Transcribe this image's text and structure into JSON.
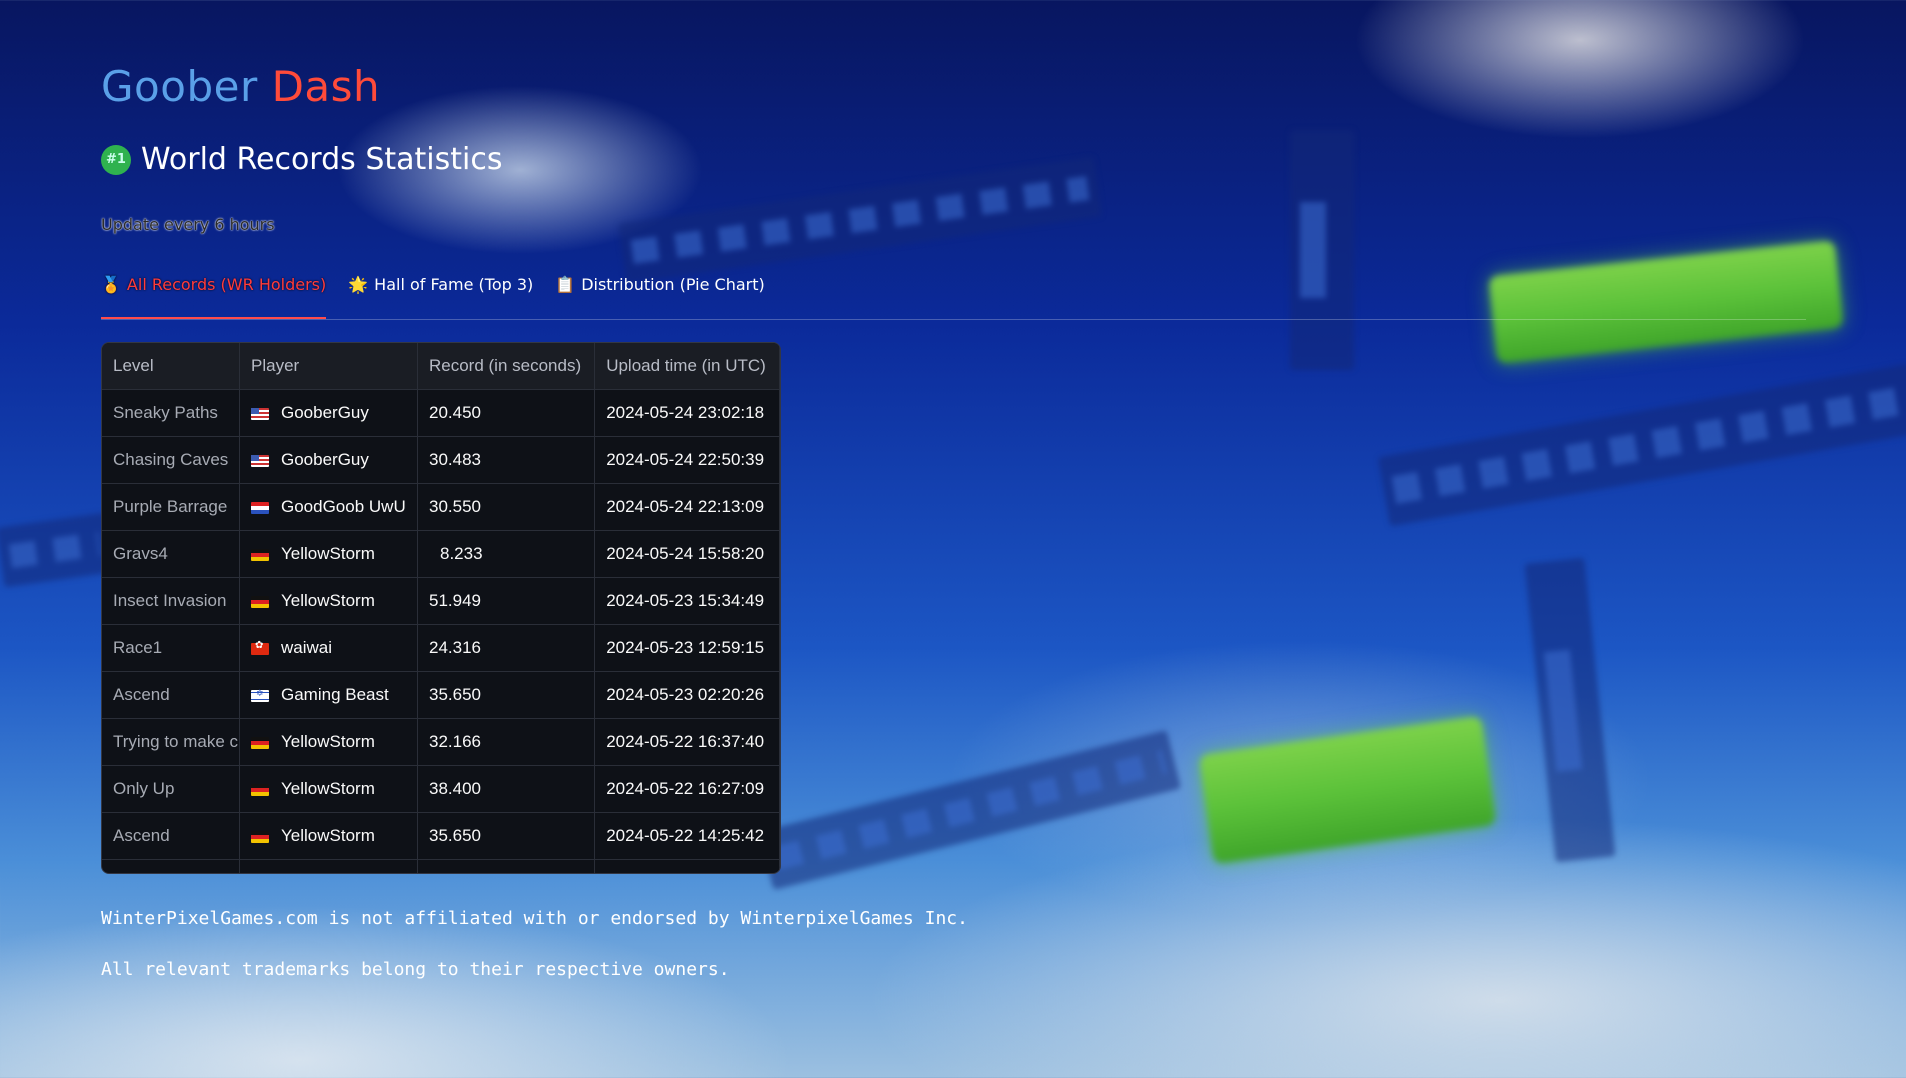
{
  "header": {
    "title_part1": "Goober",
    "title_part2": "Dash",
    "subtitle": "World Records Statistics",
    "subtitle_badge": "#1",
    "update_note": "Update every 6 hours"
  },
  "tabs": [
    {
      "icon": "🏅",
      "label": "All Records (WR Holders)",
      "active": true
    },
    {
      "icon": "🌟",
      "label": "Hall of Fame (Top 3)",
      "active": false
    },
    {
      "icon": "📋",
      "label": "Distribution (Pie Chart)",
      "active": false
    }
  ],
  "table": {
    "columns": [
      "Level",
      "Player",
      "Record (in seconds)",
      "Upload time (in UTC)"
    ],
    "rows": [
      {
        "level": "Sneaky Paths",
        "flag": "us",
        "player": "GooberGuy",
        "record": "20.450",
        "time": "2024-05-24 23:02:18"
      },
      {
        "level": "Chasing Caves",
        "flag": "us",
        "player": "GooberGuy",
        "record": "30.483",
        "time": "2024-05-24 22:50:39"
      },
      {
        "level": "Purple Barrage",
        "flag": "nl",
        "player": "GoodGoob UwU",
        "record": "30.550",
        "time": "2024-05-24 22:13:09"
      },
      {
        "level": "Gravs4",
        "flag": "de",
        "player": "YellowStorm",
        "record": "8.233",
        "time": "2024-05-24 15:58:20"
      },
      {
        "level": "Insect Invasion",
        "flag": "de",
        "player": "YellowStorm",
        "record": "51.949",
        "time": "2024-05-23 15:34:49"
      },
      {
        "level": "Race1",
        "flag": "hk",
        "player": "waiwai",
        "record": "24.316",
        "time": "2024-05-23 12:59:15"
      },
      {
        "level": "Ascend",
        "flag": "il",
        "player": "Gaming Beast",
        "record": "35.650",
        "time": "2024-05-23 02:20:26"
      },
      {
        "level": "Trying to make c",
        "flag": "de",
        "player": "YellowStorm",
        "record": "32.166",
        "time": "2024-05-22 16:37:40"
      },
      {
        "level": "Only Up",
        "flag": "de",
        "player": "YellowStorm",
        "record": "38.400",
        "time": "2024-05-22 16:27:09"
      },
      {
        "level": "Ascend",
        "flag": "de",
        "player": "YellowStorm",
        "record": "35.650",
        "time": "2024-05-22 14:25:42"
      }
    ]
  },
  "footer": {
    "disclaimer": "WinterPixelGames.com is not affiliated with or endorsed by WinterpixelGames Inc.",
    "trademarks": "All relevant trademarks belong to their respective owners."
  },
  "colors": {
    "accent_red": "#ff4b4b",
    "title_blue": "#5aa0e8",
    "table_bg": "#0e1117"
  }
}
